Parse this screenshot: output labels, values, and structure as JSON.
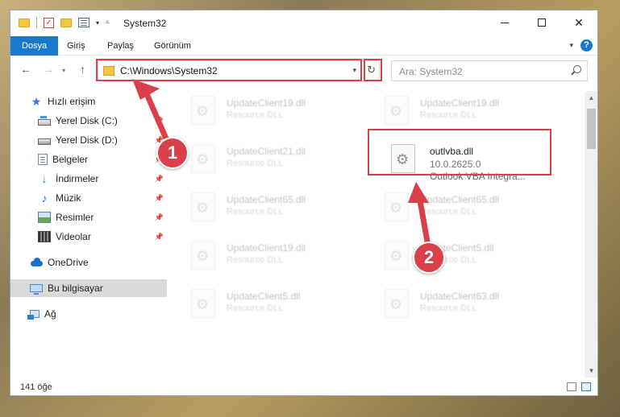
{
  "window": {
    "title": "System32"
  },
  "ribbon": {
    "tabs": [
      "Dosya",
      "Giriş",
      "Paylaş",
      "Görünüm"
    ],
    "help": "?"
  },
  "address": {
    "path": "C:\\Windows\\System32"
  },
  "search": {
    "placeholder": "Ara: System32"
  },
  "sidebar": {
    "items": [
      {
        "label": "Hızlı erişim"
      },
      {
        "label": "Yerel Disk (C:)"
      },
      {
        "label": "Yerel Disk (D:)"
      },
      {
        "label": "Belgeler"
      },
      {
        "label": "İndirmeler"
      },
      {
        "label": "Müzik"
      },
      {
        "label": "Resimler"
      },
      {
        "label": "Videolar"
      },
      {
        "label": "OneDrive"
      },
      {
        "label": "Bu bilgisayar"
      },
      {
        "label": "Ağ"
      }
    ]
  },
  "files": [
    {
      "name": "UpdateClient19.dll",
      "desc": "Resource DLL"
    },
    {
      "name": "UpdateClient19.dll",
      "desc": "Resource DLL"
    },
    {
      "name": "UpdateClient21.dll",
      "desc": "Resource DLL"
    },
    {
      "name": "outlvba.dll",
      "version": "10.0.2625.0",
      "desc": "Outlook VBA Integra..."
    },
    {
      "name": "UpdateClient65.dll",
      "desc": "Resource DLL"
    },
    {
      "name": "UpdateClient65.dll",
      "desc": "Resource DLL"
    },
    {
      "name": "UpdateClient19.dll",
      "desc": "Resource DLL"
    },
    {
      "name": "UpdateClient5.dll",
      "desc": "Resource DLL"
    },
    {
      "name": "UpdateClient5.dll",
      "desc": "Resource DLL"
    },
    {
      "name": "UpdateClient63.dll",
      "desc": "Resource DLL"
    }
  ],
  "status": {
    "count": "141 öğe"
  },
  "annotations": {
    "step1": "1",
    "step2": "2"
  },
  "colors": {
    "accent": "#1979ca",
    "highlight": "#d9404a"
  }
}
